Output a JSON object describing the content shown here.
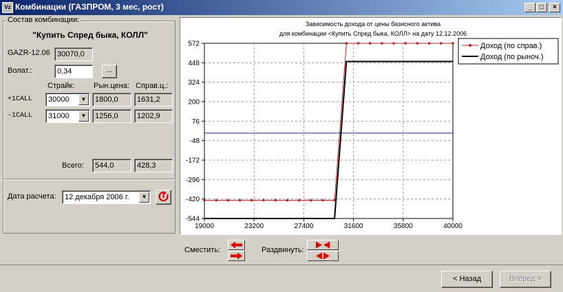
{
  "window": {
    "title": "Комбинации (ГАЗПРОМ, 3 мес, рост)",
    "app_icon": "Vz",
    "controls": {
      "minimize": "_",
      "maximize": "□",
      "close": "×"
    }
  },
  "left_panel": {
    "group_title": "Состав комбинации:",
    "combo_name": "\"Купить Спред быка, КОЛЛ\"",
    "asset_label": "GAZR-12.06",
    "asset_price": "30070,0",
    "volat_label": "Волат.:",
    "volat_value": "0,34",
    "volat_button": "...",
    "headers": {
      "strike": "Страйк:",
      "market": "Рын.цена:",
      "fair": "Справ.ц.:"
    },
    "legs": [
      {
        "label": "+1CALL",
        "strike": "30000",
        "market": "1800,0",
        "fair": "1631,2"
      },
      {
        "label": "-1CALL",
        "strike": "31000",
        "market": "1256,0",
        "fair": "1202,9"
      }
    ],
    "total_label": "Всего:",
    "total_market": "544,0",
    "total_fair": "428,3",
    "date_label": "Дата расчета:",
    "date_value": "12 декабря  2006 г."
  },
  "chart_data": {
    "type": "line",
    "title": "Зависимость дохода от цены базисного актива",
    "subtitle": "для комбинации <Купить Спред быка, КОЛЛ> на дату 12.12.2006",
    "xlim": [
      19000,
      40000
    ],
    "ylim": [
      -544,
      572
    ],
    "x_ticks": [
      19000,
      23200,
      27400,
      31600,
      35800,
      40000
    ],
    "y_ticks": [
      572,
      448,
      324,
      200,
      76,
      -48,
      -172,
      -296,
      -420,
      -544
    ],
    "grid": true,
    "zero_line": 0,
    "legend_position": "top-right",
    "series": [
      {
        "name": "Доход (по справ.)",
        "color": "#b22222",
        "marker": "dot",
        "x": [
          19000,
          20000,
          21000,
          22000,
          23000,
          24000,
          25000,
          26000,
          27000,
          28000,
          29000,
          30000,
          31000,
          32000,
          33000,
          34000,
          35000,
          36000,
          37000,
          38000,
          39000,
          40000
        ],
        "y": [
          -428,
          -428,
          -428,
          -428,
          -428,
          -428,
          -428,
          -428,
          -428,
          -428,
          -428,
          -428,
          572,
          572,
          572,
          572,
          572,
          572,
          572,
          572,
          572,
          572
        ]
      },
      {
        "name": "Доход (по рыноч.)",
        "color": "#000000",
        "marker": "none",
        "x": [
          19000,
          30000,
          31000,
          40000
        ],
        "y": [
          -544,
          -544,
          456,
          456
        ]
      }
    ]
  },
  "bottom": {
    "shift_label": "Сместить:",
    "spread_label": "Раздвинуть:",
    "back_label": "< Назад",
    "next_label": "Вперед >"
  }
}
